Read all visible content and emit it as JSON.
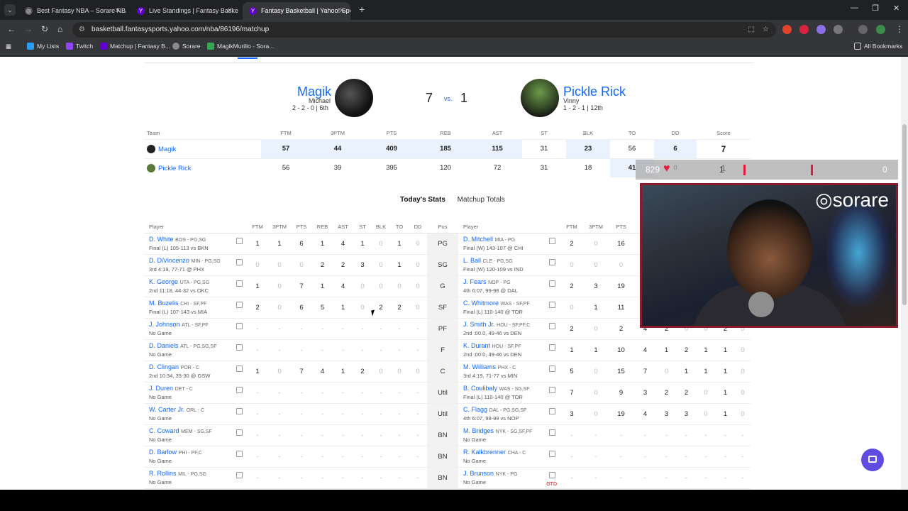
{
  "browser": {
    "tabs": [
      {
        "title": "Best Fantasy NBA – Sorare NBA",
        "active": false
      },
      {
        "title": "Live Standings | Fantasy Basketb",
        "active": false
      },
      {
        "title": "Fantasy Basketball | Yahoo! Spo",
        "active": true
      }
    ],
    "url": "basketball.fantasysports.yahoo.com/nba/86196/matchup",
    "bookmarks": [
      "My Lists",
      "Twitch",
      "Matchup | Fantasy B...",
      "Sorare",
      "MagikMurillo - Sora..."
    ],
    "all_bookmarks": "All Bookmarks"
  },
  "matchup": {
    "team1": {
      "name": "Magik",
      "owner": "Michael",
      "record": "2 - 2 - 0 | 6th",
      "score": "7"
    },
    "vs": "vs.",
    "team2": {
      "name": "Pickle Rick",
      "owner": "Vinny",
      "record": "1 - 2 - 1 | 12th",
      "score": "1"
    }
  },
  "summary": {
    "headers": [
      "Team",
      "FTM",
      "3PTM",
      "PTS",
      "REB",
      "AST",
      "ST",
      "BLK",
      "TO",
      "DD",
      "Score"
    ],
    "rows": [
      {
        "team": "Magik",
        "vals": [
          "57",
          "44",
          "409",
          "185",
          "115",
          "31",
          "23",
          "56",
          "6",
          "7"
        ]
      },
      {
        "team": "Pickle Rick",
        "vals": [
          "56",
          "39",
          "395",
          "120",
          "72",
          "31",
          "18",
          "41",
          "0",
          "1"
        ]
      }
    ]
  },
  "subtabs": {
    "today": "Today's Stats",
    "totals": "Matchup Totals"
  },
  "stats_headers": {
    "left": [
      "Player",
      "FTM",
      "3PTM",
      "PTS",
      "REB",
      "AST",
      "ST",
      "BLK",
      "TO",
      "DD"
    ],
    "pos": "Pos",
    "right": [
      "Player",
      "FTM",
      "3PTM",
      "PTS",
      "R"
    ]
  },
  "rows": [
    {
      "pos": "PG",
      "l": {
        "name": "D. White",
        "team": "BOS - PG,SG",
        "game": "Final (L) 105-113 vs BKN",
        "s": [
          "1",
          "1",
          "6",
          "1",
          "4",
          "1",
          "0",
          "1",
          "0"
        ]
      },
      "r": {
        "name": "D. Mitchell",
        "team": "MIA - PG",
        "game": "Final (W) 143-107 @ CHI",
        "s": [
          "2",
          "0",
          "16",
          "",
          "",
          "",
          "",
          "",
          ""
        ]
      }
    },
    {
      "pos": "SG",
      "l": {
        "name": "D. DiVincenzo",
        "team": "MIN - PG,SG",
        "game": "3rd 4:19, 77-71 @ PHX",
        "s": [
          "0",
          "0",
          "0",
          "2",
          "2",
          "3",
          "0",
          "1",
          "0"
        ]
      },
      "r": {
        "name": "L. Ball",
        "team": "CLE - PG,SG",
        "game": "Final (W) 120-109 vs IND",
        "s": [
          "0",
          "0",
          "0",
          "",
          "",
          "",
          "",
          "",
          ""
        ]
      }
    },
    {
      "pos": "G",
      "l": {
        "name": "K. George",
        "team": "UTA - PG,SG",
        "game": "2nd 11:18, 44-32 vs OKC",
        "s": [
          "1",
          "0",
          "7",
          "1",
          "4",
          "0",
          "0",
          "0",
          "0"
        ]
      },
      "r": {
        "name": "J. Fears",
        "team": "NOP - PG",
        "game": "4th 6:07, 99-98 @ DAL",
        "s": [
          "2",
          "3",
          "19",
          "",
          "",
          "",
          "",
          "",
          ""
        ]
      }
    },
    {
      "pos": "SF",
      "l": {
        "name": "M. Buzelis",
        "team": "CHI - SF,PF",
        "game": "Final (L) 107-143 vs MIA",
        "s": [
          "2",
          "0",
          "6",
          "5",
          "1",
          "0",
          "2",
          "2",
          "0"
        ]
      },
      "r": {
        "name": "C. Whitmore",
        "team": "WAS - SF,PF",
        "game": "Final (L) 110-140 @ TOR",
        "s": [
          "0",
          "1",
          "11",
          "",
          "",
          "",
          "",
          "",
          ""
        ]
      }
    },
    {
      "pos": "PF",
      "l": {
        "name": "J. Johnson",
        "team": "ATL - SF,PF",
        "game": "No Game",
        "s": [
          "-",
          "-",
          "-",
          "-",
          "-",
          "-",
          "-",
          "-",
          "-"
        ]
      },
      "r": {
        "name": "J. Smith Jr.",
        "team": "HOU - SF,PF,C",
        "game": "2nd :00.0, 49-46 vs DEN",
        "s": [
          "2",
          "0",
          "2",
          "4",
          "2",
          "0",
          "0",
          "2",
          "0"
        ]
      }
    },
    {
      "pos": "F",
      "l": {
        "name": "D. Daniels",
        "team": "ATL - PG,SG,SF",
        "game": "No Game",
        "s": [
          "-",
          "-",
          "-",
          "-",
          "-",
          "-",
          "-",
          "-",
          "-"
        ]
      },
      "r": {
        "name": "K. Durant",
        "team": "HOU - SF,PF",
        "game": "2nd :00.0, 49-46 vs DEN",
        "s": [
          "1",
          "1",
          "10",
          "4",
          "1",
          "2",
          "1",
          "1",
          "0"
        ]
      }
    },
    {
      "pos": "C",
      "l": {
        "name": "D. Clingan",
        "team": "POR - C",
        "game": "2nd 10:34, 35-30 @ GSW",
        "s": [
          "1",
          "0",
          "7",
          "4",
          "1",
          "2",
          "0",
          "0",
          "0"
        ]
      },
      "r": {
        "name": "M. Williams",
        "team": "PHX - C",
        "game": "3rd 4:19, 71-77 vs MIN",
        "s": [
          "5",
          "0",
          "15",
          "7",
          "0",
          "1",
          "1",
          "1",
          "0"
        ]
      }
    },
    {
      "pos": "Util",
      "l": {
        "name": "J. Duren",
        "team": "DET - C",
        "game": "No Game",
        "s": [
          "-",
          "-",
          "-",
          "-",
          "-",
          "-",
          "-",
          "-",
          "-"
        ]
      },
      "r": {
        "name": "B. Coulibaly",
        "team": "WAS - SG,SF",
        "game": "Final (L) 110-140 @ TOR",
        "s": [
          "7",
          "0",
          "9",
          "3",
          "2",
          "2",
          "0",
          "1",
          "0"
        ]
      }
    },
    {
      "pos": "Util",
      "l": {
        "name": "W. Carter Jr.",
        "team": "ORL - C",
        "game": "No Game",
        "s": [
          "-",
          "-",
          "-",
          "-",
          "-",
          "-",
          "-",
          "-",
          "-"
        ]
      },
      "r": {
        "name": "C. Flagg",
        "team": "DAL - PG,SG,SF",
        "game": "4th 6:07, 98-99 vs NOP",
        "s": [
          "3",
          "0",
          "19",
          "4",
          "3",
          "3",
          "0",
          "1",
          "0"
        ]
      }
    },
    {
      "pos": "BN",
      "l": {
        "name": "C. Coward",
        "team": "MEM - SG,SF",
        "game": "No Game",
        "s": [
          "-",
          "-",
          "-",
          "-",
          "-",
          "-",
          "-",
          "-",
          "-"
        ]
      },
      "r": {
        "name": "M. Bridges",
        "team": "NYK - SG,SF,PF",
        "game": "No Game",
        "s": [
          "-",
          "-",
          "-",
          "-",
          "-",
          "-",
          "-",
          "-",
          "-"
        ]
      }
    },
    {
      "pos": "BN",
      "l": {
        "name": "D. Barlow",
        "team": "PHI - PF,C",
        "game": "No Game",
        "s": [
          "-",
          "-",
          "-",
          "-",
          "-",
          "-",
          "-",
          "-",
          "-"
        ]
      },
      "r": {
        "name": "R. Kalkbrenner",
        "team": "CHA - C",
        "game": "No Game",
        "s": [
          "-",
          "-",
          "-",
          "-",
          "-",
          "-",
          "-",
          "-",
          "-"
        ]
      }
    },
    {
      "pos": "BN",
      "l": {
        "name": "R. Rollins",
        "team": "MIL - PG,SG",
        "game": "No Game",
        "s": [
          "-",
          "-",
          "-",
          "-",
          "-",
          "-",
          "-",
          "-",
          "-"
        ]
      },
      "r": {
        "name": "J. Brunson",
        "team": "NYK - PG",
        "game": "No Game",
        "s": [
          "-",
          "-",
          "-",
          "-",
          "-",
          "-",
          "-",
          "-",
          "-"
        ],
        "tag": "GTD"
      }
    }
  ],
  "overlay": {
    "count": "829",
    "score_left": "1",
    "score_right": "0",
    "brand": "sorare"
  }
}
